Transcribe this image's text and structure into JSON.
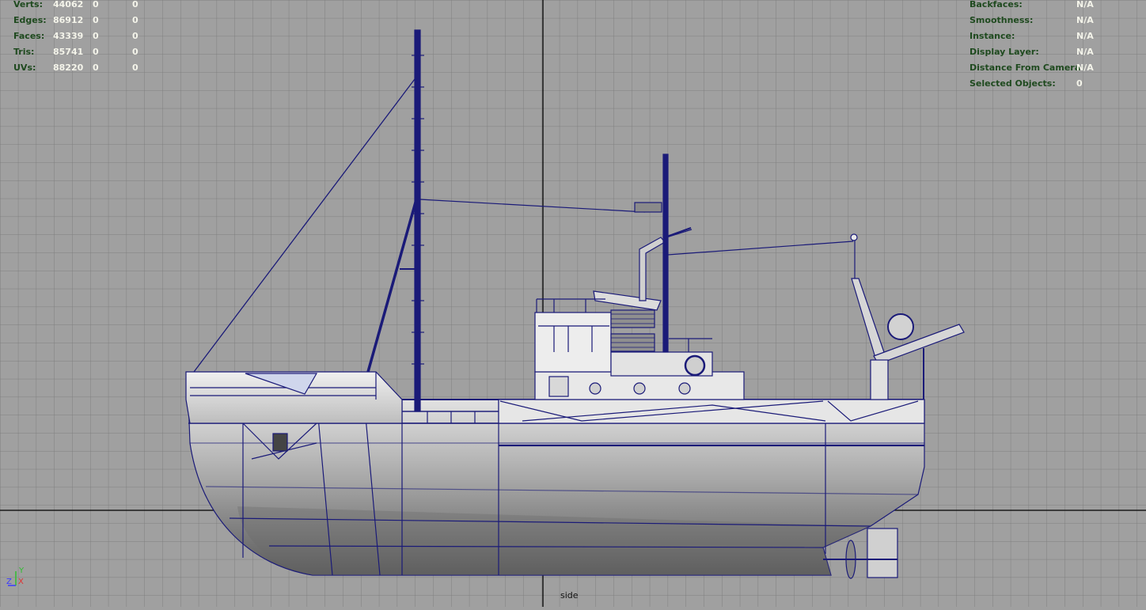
{
  "hud_left": {
    "rows": [
      {
        "label": "Verts:",
        "values": [
          "44062",
          "0",
          "0"
        ]
      },
      {
        "label": "Edges:",
        "values": [
          "86912",
          "0",
          "0"
        ]
      },
      {
        "label": "Faces:",
        "values": [
          "43339",
          "0",
          "0"
        ]
      },
      {
        "label": "Tris:",
        "values": [
          "85741",
          "0",
          "0"
        ]
      },
      {
        "label": "UVs:",
        "values": [
          "88220",
          "0",
          "0"
        ]
      }
    ]
  },
  "hud_right": {
    "rows": [
      {
        "label": "Backfaces:",
        "value": "N/A"
      },
      {
        "label": "Smoothness:",
        "value": "N/A"
      },
      {
        "label": "Instance:",
        "value": "N/A"
      },
      {
        "label": "Display Layer:",
        "value": "N/A"
      },
      {
        "label": "Distance From Camera:",
        "value": "N/A"
      },
      {
        "label": "Selected Objects:",
        "value": "0"
      }
    ]
  },
  "camera_label": "side",
  "axis": {
    "y": "Y",
    "z": "Z",
    "x": "X"
  },
  "colors": {
    "viewport_bg": "#a0a0a0",
    "grid": "#7f7f7f",
    "axis_line": "#000000",
    "wire": "#1a1a78",
    "hud_label": "#1f4a1f",
    "hud_value": "#f4f4ea"
  }
}
